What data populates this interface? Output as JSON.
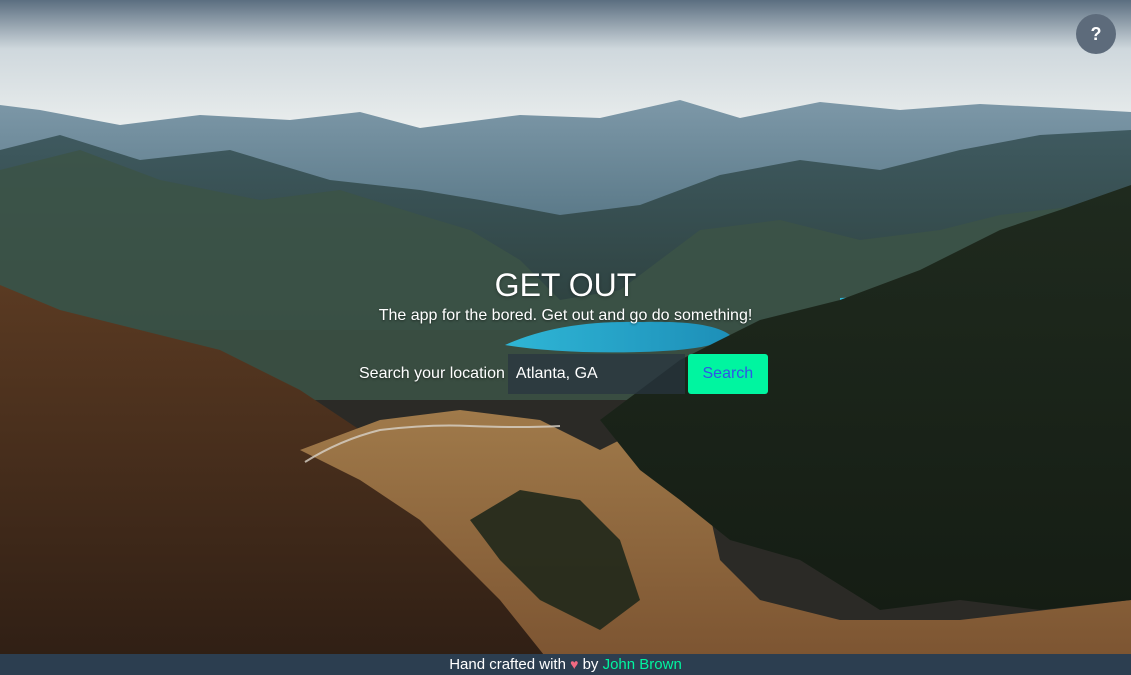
{
  "help": {
    "label": "?"
  },
  "hero": {
    "title": "GET OUT",
    "subtitle": "The app for the bored. Get out and go do something!"
  },
  "search": {
    "label": "Search your location",
    "value": "Atlanta, GA",
    "button_label": "Search"
  },
  "footer": {
    "prefix": "Hand crafted with",
    "heart_glyph": "♥",
    "by_text": "by",
    "author": "John Brown"
  },
  "colors": {
    "accent": "#00f5a0",
    "button_text": "#2f55e6",
    "footer_bg": "#2c3e50",
    "help_bg": "#5d6b7b",
    "heart": "#f06a82"
  }
}
